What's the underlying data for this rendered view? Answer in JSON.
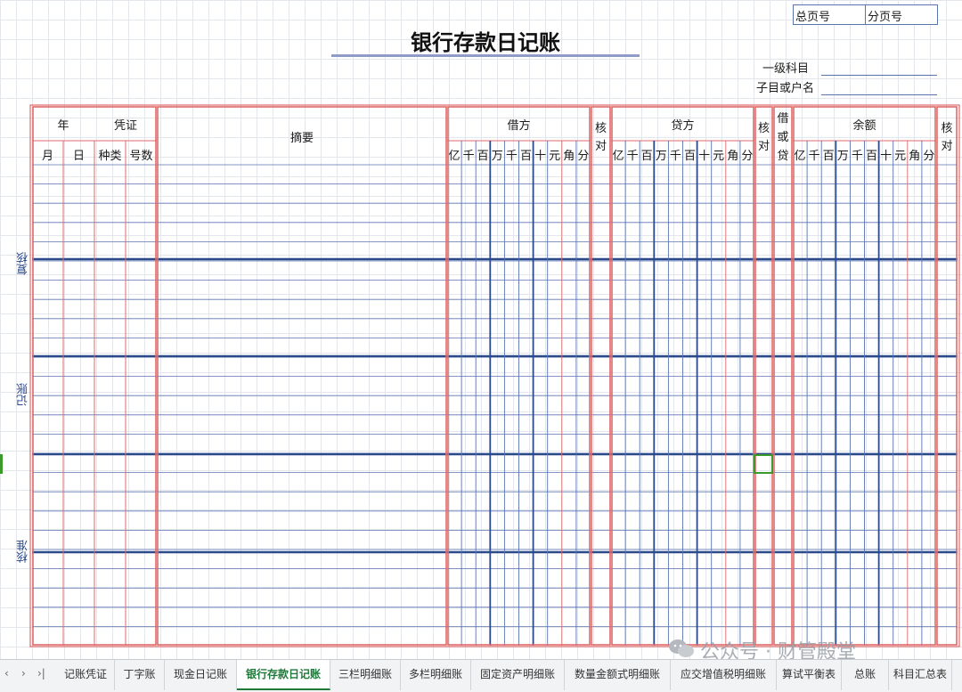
{
  "sheet": {
    "title": "银行存款日记账",
    "total_page_label": "总页号",
    "sub_page_label": "分页号",
    "level1_account_label": "一级科目",
    "sub_account_label": "子目或户名"
  },
  "table_headers": {
    "year": "年",
    "voucher": "凭证",
    "month": "月",
    "day": "日",
    "voucher_type": "种类",
    "voucher_number": "号数",
    "summary": "摘要",
    "debit": "借方",
    "check1_a": "核",
    "check1_b": "对",
    "credit": "贷方",
    "check2_a": "核",
    "check2_b": "对",
    "dc_a": "借",
    "dc_b": "或",
    "dc_c": "贷",
    "balance": "余额",
    "check3_a": "核",
    "check3_b": "对",
    "digit_units": [
      "亿",
      "千",
      "百",
      "万",
      "千",
      "百",
      "十",
      "元",
      "角",
      "分"
    ]
  },
  "side_labels": {
    "review": "复核",
    "bookkeeping": "记账",
    "approve": "核准"
  },
  "tabs": [
    "记账凭证",
    "丁字账",
    "现金日记账",
    "银行存款日记账",
    "三栏明细账",
    "多栏明细账",
    "固定资产明细账",
    "数量金额式明细账",
    "应交增值税明细账",
    "算试平衡表",
    "总账",
    "科目汇总表"
  ],
  "active_tab": "银行存款日记账",
  "watermark": "公众号 · 财管殿堂",
  "colors": {
    "red_border": "#e06a6a",
    "blue_line": "#2b4a8c",
    "thin_blue": "#5a74b0",
    "active_tab": "#1f7a3a",
    "selected_cell": "#3a9a2a"
  }
}
